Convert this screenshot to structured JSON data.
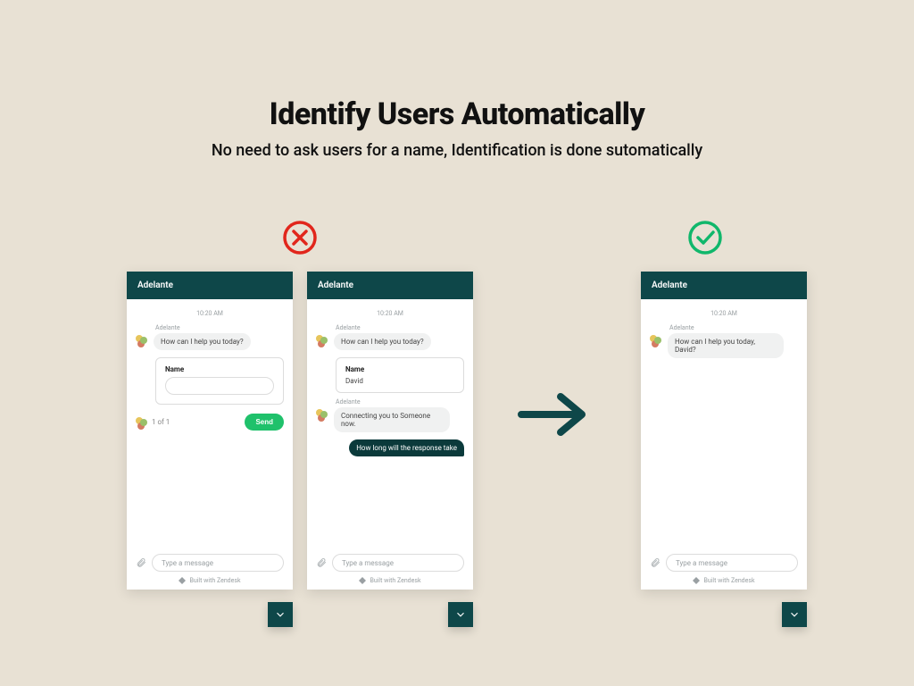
{
  "heading": {
    "title": "Identify Users Automatically",
    "subtitle": "No need to ask users for a name, Identification is done sutomatically"
  },
  "status": {
    "wrong": "wrong",
    "correct": "correct"
  },
  "common": {
    "input_placeholder": "Type a message",
    "built_with": "Built with Zendesk"
  },
  "chat1": {
    "title": "Adelante",
    "timestamp": "10:20 AM",
    "sender": "Adelante",
    "greeting": "How can I help you today?",
    "form": {
      "name_label": "Name",
      "count": "1 of 1",
      "send": "Send"
    }
  },
  "chat2": {
    "title": "Adelante",
    "timestamp": "10:20 AM",
    "sender": "Adelante",
    "greeting": "How can I help you today?",
    "form": {
      "name_label": "Name",
      "name_value": "David"
    },
    "sender2": "Adelante",
    "connecting": "Connecting you to Someone now.",
    "user_msg": "How long will the response take"
  },
  "chat3": {
    "title": "Adelante",
    "timestamp": "10:20 AM",
    "sender": "Adelante",
    "greeting": "How can I help you today, David?"
  }
}
